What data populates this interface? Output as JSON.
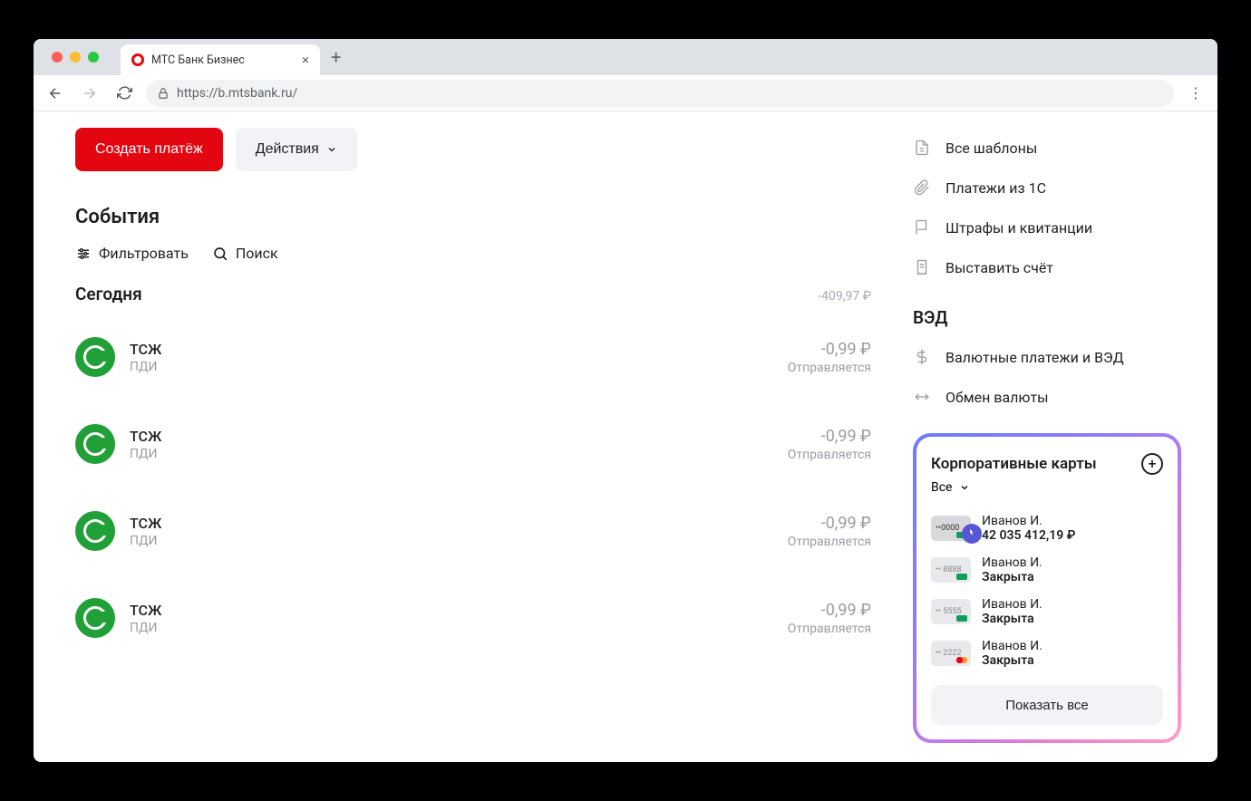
{
  "browser": {
    "tab_title": "МТС Банк Бизнес",
    "url": "https://b.mtsbank.ru/"
  },
  "actions": {
    "create_payment": "Создать платёж",
    "actions_label": "Действия"
  },
  "events": {
    "heading": "События",
    "filter_label": "Фильтровать",
    "search_label": "Поиск",
    "today_label": "Сегодня",
    "today_total": "-409,97 ₽",
    "items": [
      {
        "name": "ТСЖ",
        "sub": "ПДИ",
        "amount": "-0,99 ₽",
        "status": "Отправляется"
      },
      {
        "name": "ТСЖ",
        "sub": "ПДИ",
        "amount": "-0,99 ₽",
        "status": "Отправляется"
      },
      {
        "name": "ТСЖ",
        "sub": "ПДИ",
        "amount": "-0,99 ₽",
        "status": "Отправляется"
      },
      {
        "name": "ТСЖ",
        "sub": "ПДИ",
        "amount": "-0,99 ₽",
        "status": "Отправляется"
      }
    ]
  },
  "quicklinks": {
    "all_templates": "Все шаблоны",
    "payments_1c": "Платежи из 1С",
    "fines": "Штрафы и квитанции",
    "invoice": "Выставить счёт",
    "ved_heading": "ВЭД",
    "currency_payments": "Валютные платежи и ВЭД",
    "currency_exchange": "Обмен валюты"
  },
  "cards_panel": {
    "title": "Корпоративные карты",
    "filter": "Все",
    "show_all": "Показать все",
    "cards": [
      {
        "mask": "••0000",
        "holder": "Иванов И.",
        "balance": "42 035 412,19 ₽",
        "active": true,
        "scheme": "mir"
      },
      {
        "mask": "•• 8888",
        "holder": "Иванов И.",
        "balance": "Закрыта",
        "active": false,
        "scheme": "mir"
      },
      {
        "mask": "•• 5555",
        "holder": "Иванов И.",
        "balance": "Закрыта",
        "active": false,
        "scheme": "mir"
      },
      {
        "mask": "•• 2222",
        "holder": "Иванов И.",
        "balance": "Закрыта",
        "active": false,
        "scheme": "mc"
      }
    ]
  }
}
